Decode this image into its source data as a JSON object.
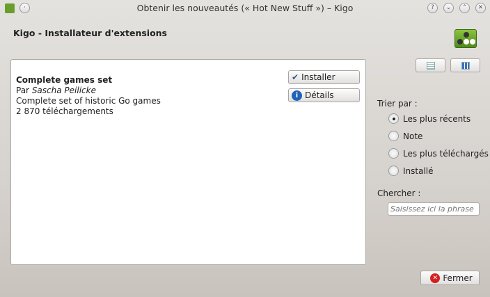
{
  "window": {
    "title": "Obtenir les nouveautés (« Hot New Stuff ») – Kigo",
    "help": "?",
    "minimize": "⌄",
    "maximize": "⌃",
    "close": "✕"
  },
  "header": {
    "title": "Kigo - Installateur d'extensions"
  },
  "item": {
    "name": "Complete games set",
    "author_prefix": "Par ",
    "author": "Sascha Peilicke",
    "summary": "Complete set of historic Go games",
    "downloads": "2 870 téléchargements"
  },
  "actions": {
    "install": "Installer",
    "details": "Détails"
  },
  "sort": {
    "label": "Trier par :",
    "options": [
      {
        "label": "Les plus récents",
        "selected": true
      },
      {
        "label": "Note"
      },
      {
        "label": "Les plus téléchargés"
      },
      {
        "label": "Installé"
      }
    ]
  },
  "search": {
    "label": "Chercher :",
    "placeholder": "Saisissez ici la phrase"
  },
  "footer": {
    "close": "Fermer"
  }
}
